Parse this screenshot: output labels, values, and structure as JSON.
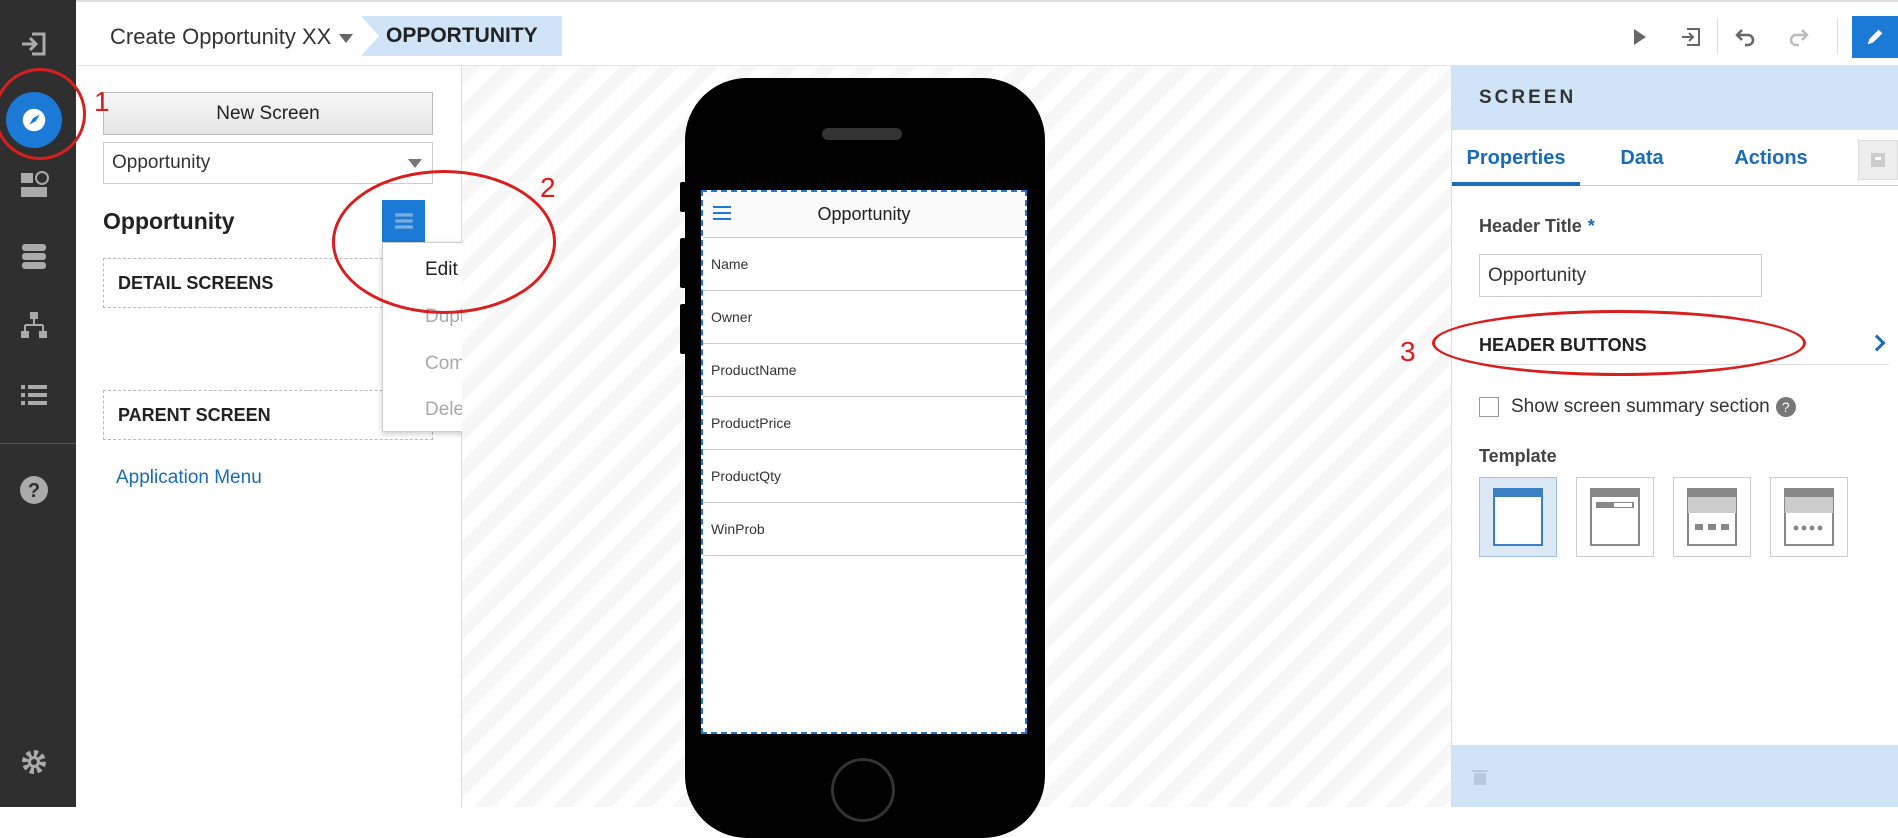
{
  "topbar": {
    "app_title": "Create Opportunity XX",
    "breadcrumb": "OPPORTUNITY"
  },
  "left_panel": {
    "new_screen_label": "New Screen",
    "screen_select_value": "Opportunity",
    "screen_title": "Opportunity",
    "detail_screens_label": "DETAIL SCREENS",
    "parent_screen_label": "PARENT SCREEN",
    "app_menu_link": "Application Menu"
  },
  "context_menu": {
    "items": [
      {
        "label": "Edit",
        "enabled": true
      },
      {
        "label": "Duplicate",
        "enabled": false
      },
      {
        "label": "Components",
        "enabled": false
      },
      {
        "label": "Delete",
        "enabled": false
      }
    ]
  },
  "phone": {
    "header_title": "Opportunity",
    "rows": [
      "Name",
      "Owner",
      "ProductName",
      "ProductPrice",
      "ProductQty",
      "WinProb"
    ]
  },
  "right_panel": {
    "header": "SCREEN",
    "tabs": [
      "Properties",
      "Data",
      "Actions"
    ],
    "active_tab": "Properties",
    "header_title_label": "Header Title",
    "required_marker": "*",
    "header_title_value": "Opportunity",
    "header_buttons_label": "HEADER BUTTONS",
    "show_summary_label": "Show screen summary section",
    "help_glyph": "?",
    "template_label": "Template",
    "selected_template_index": 0
  },
  "annotations": [
    "1",
    "2",
    "3"
  ],
  "colors": {
    "rail_bg": "#2f2f2f",
    "accent_blue": "#1a7ad6",
    "light_blue": "#cfe4f7",
    "annotation_red": "#d91e1e"
  }
}
